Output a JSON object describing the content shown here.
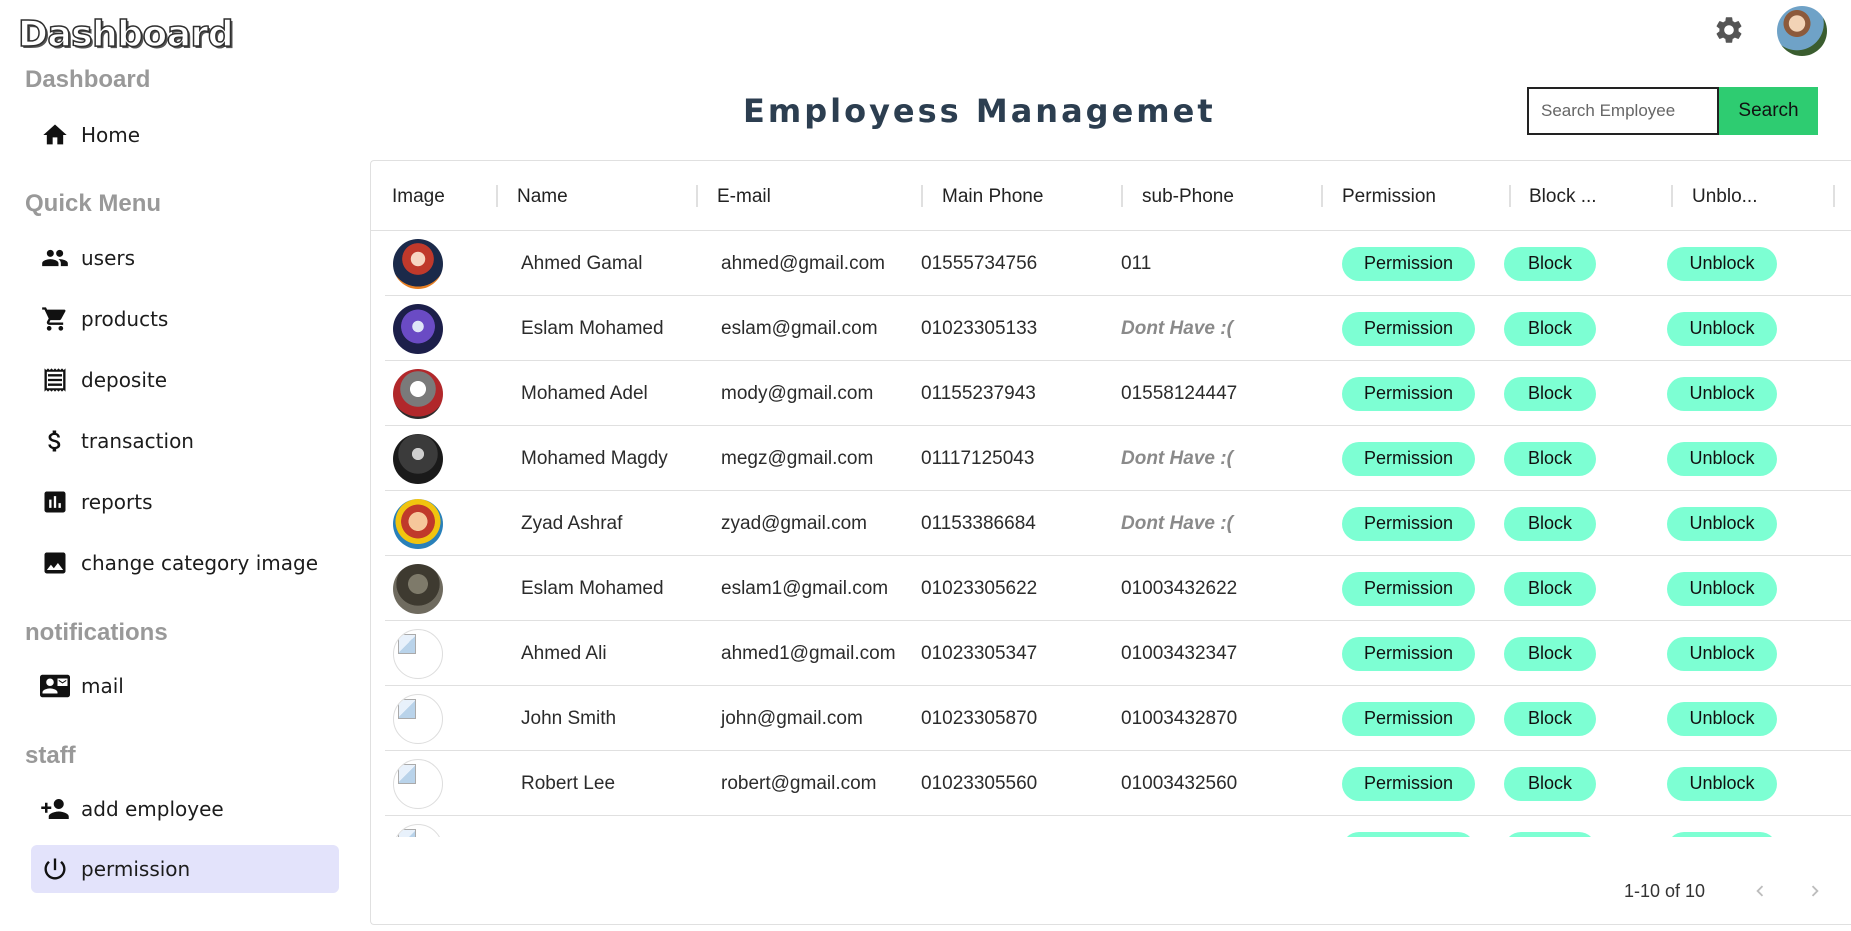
{
  "brand": "Dashboard",
  "header": {
    "settings_icon": "gear-icon",
    "avatar": "user-avatar"
  },
  "sidebar": {
    "sections": {
      "dashboard": "Dashboard",
      "quick_menu": "Quick Menu",
      "notifications": "notifications",
      "staff": "staff"
    },
    "items": [
      {
        "label": "Home",
        "icon": "home-icon"
      },
      {
        "label": "users",
        "icon": "users-icon"
      },
      {
        "label": "products",
        "icon": "cart-icon"
      },
      {
        "label": "deposite",
        "icon": "receipt-icon"
      },
      {
        "label": "transaction",
        "icon": "dollar-icon"
      },
      {
        "label": "reports",
        "icon": "bar-chart-icon"
      },
      {
        "label": "change category image",
        "icon": "image-icon"
      },
      {
        "label": "mail",
        "icon": "contact-mail-icon"
      },
      {
        "label": "add employee",
        "icon": "person-add-icon"
      },
      {
        "label": "permission",
        "icon": "power-icon",
        "active": true
      }
    ]
  },
  "main": {
    "title": "Employess Managemet",
    "search": {
      "placeholder": "Search Employee",
      "button": "Search"
    },
    "table": {
      "columns": [
        "Image",
        "Name",
        "E-mail",
        "Main Phone",
        "sub-Phone",
        "Permission",
        "Block ...",
        "Unblo..."
      ],
      "action_labels": {
        "permission": "Permission",
        "block": "Block",
        "unblock": "Unblock"
      },
      "rows": [
        {
          "name": "Ahmed Gamal",
          "email": "ahmed@gmail.com",
          "main_phone": "01555734756",
          "sub_phone": "011",
          "image": "avatar-1"
        },
        {
          "name": "Eslam Mohamed",
          "email": "eslam@gmail.com",
          "main_phone": "01023305133",
          "sub_phone": "Dont Have :(",
          "image": "avatar-2"
        },
        {
          "name": "Mohamed Adel",
          "email": "mody@gmail.com",
          "main_phone": "01155237943",
          "sub_phone": "01558124447",
          "image": "avatar-3"
        },
        {
          "name": "Mohamed Magdy",
          "email": "megz@gmail.com",
          "main_phone": "01117125043",
          "sub_phone": "Dont Have :(",
          "image": "avatar-4"
        },
        {
          "name": "Zyad Ashraf",
          "email": "zyad@gmail.com",
          "main_phone": "01153386684",
          "sub_phone": "Dont Have :(",
          "image": "avatar-5"
        },
        {
          "name": "Eslam Mohamed",
          "email": "eslam1@gmail.com",
          "main_phone": "01023305622",
          "sub_phone": "01003432622",
          "image": "avatar-6"
        },
        {
          "name": "Ahmed Ali",
          "email": "ahmed1@gmail.com",
          "main_phone": "01023305347",
          "sub_phone": "01003432347",
          "image": "broken"
        },
        {
          "name": "John Smith",
          "email": "john@gmail.com",
          "main_phone": "01023305870",
          "sub_phone": "01003432870",
          "image": "broken"
        },
        {
          "name": "Robert Lee",
          "email": "robert@gmail.com",
          "main_phone": "01023305560",
          "sub_phone": "01003432560",
          "image": "broken"
        },
        {
          "name": "",
          "email": "",
          "main_phone": "",
          "sub_phone": "",
          "image": "broken"
        }
      ]
    },
    "pagination": {
      "text": "1-10 of 10",
      "prev_icon": "chevron-left-icon",
      "next_icon": "chevron-right-icon"
    }
  },
  "colors": {
    "accent": "#2ecc71",
    "pill": "#7dffd3",
    "active_nav": "#e3e3fb",
    "title": "#2c3e50"
  }
}
